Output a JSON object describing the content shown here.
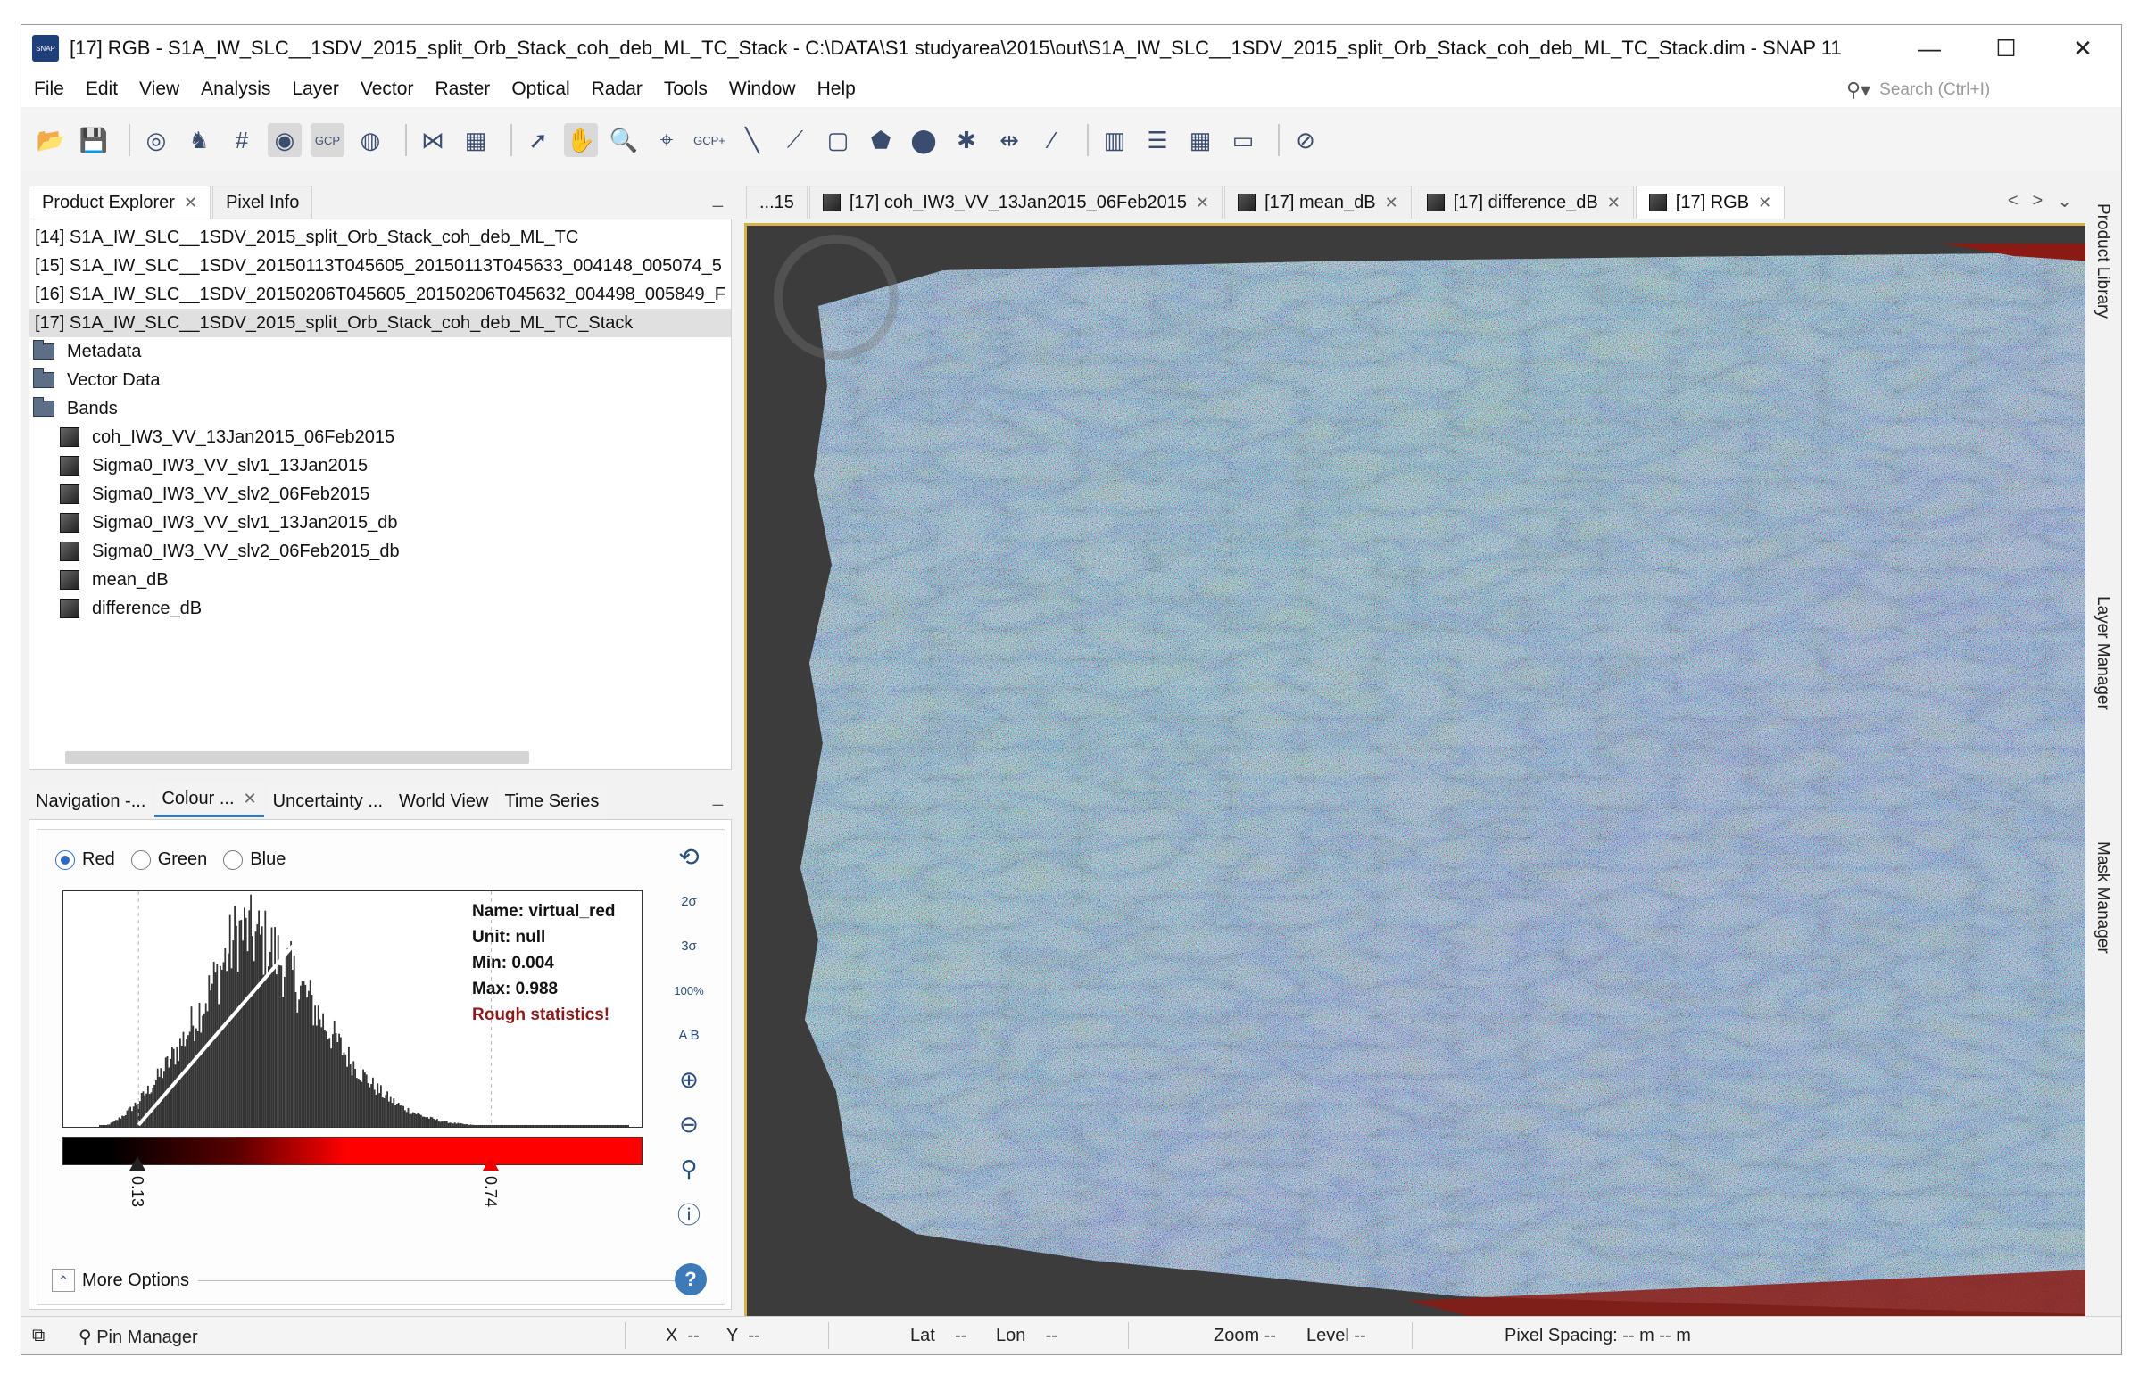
{
  "window": {
    "title": "[17] RGB - S1A_IW_SLC__1SDV_2015_split_Orb_Stack_coh_deb_ML_TC_Stack - C:\\DATA\\S1 studyarea\\2015\\out\\S1A_IW_SLC__1SDV_2015_split_Orb_Stack_coh_deb_ML_TC_Stack.dim - SNAP 11",
    "app_icon_text": "SNAP",
    "minimize": "—",
    "maximize": "☐",
    "close": "✕"
  },
  "menu": [
    "File",
    "Edit",
    "View",
    "Analysis",
    "Layer",
    "Vector",
    "Raster",
    "Optical",
    "Radar",
    "Tools",
    "Window",
    "Help"
  ],
  "search": {
    "placeholder": "Search (Ctrl+I)"
  },
  "product_explorer": {
    "tabs": [
      {
        "label": "Product Explorer",
        "closable": true
      },
      {
        "label": "Pixel Info",
        "closable": false
      }
    ],
    "minimize": "_",
    "products": [
      "[14] S1A_IW_SLC__1SDV_2015_split_Orb_Stack_coh_deb_ML_TC",
      "[15] S1A_IW_SLC__1SDV_20150113T045605_20150113T045633_004148_005074_5",
      "[16] S1A_IW_SLC__1SDV_20150206T045605_20150206T045632_004498_005849_F",
      "[17] S1A_IW_SLC__1SDV_2015_split_Orb_Stack_coh_deb_ML_TC_Stack"
    ],
    "folders": [
      "Metadata",
      "Vector Data",
      "Bands"
    ],
    "bands": [
      "coh_IW3_VV_13Jan2015_06Feb2015",
      "Sigma0_IW3_VV_slv1_13Jan2015",
      "Sigma0_IW3_VV_slv2_06Feb2015",
      "Sigma0_IW3_VV_slv1_13Jan2015_db",
      "Sigma0_IW3_VV_slv2_06Feb2015_db",
      "mean_dB",
      "difference_dB"
    ]
  },
  "colour_panel": {
    "tabs": [
      "Navigation -...",
      "Colour ...",
      "Uncertainty ...",
      "World View",
      "Time Series"
    ],
    "close_tab": "✕",
    "minimize": "_",
    "channels": [
      "Red",
      "Green",
      "Blue"
    ],
    "selected_channel": "Red",
    "stats": {
      "name": "Name: virtual_red",
      "unit": "Unit: null",
      "min": "Min: 0.004",
      "max": "Max: 0.988",
      "warning": "Rough statistics!"
    },
    "slider_min": "0.13",
    "slider_max": "0.74",
    "slider_min_frac": 0.13,
    "slider_max_frac": 0.74,
    "more_options": "More Options",
    "side_buttons": [
      "reset-icon",
      "2σ",
      "3σ",
      "100%",
      "A B",
      "zoom-in-v-icon",
      "zoom-out-v-icon",
      "zoom-icon",
      "info-icon"
    ],
    "help": "?"
  },
  "image_tabs": [
    {
      "label": "...15",
      "icon": false,
      "closable": false
    },
    {
      "label": "[17] coh_IW3_VV_13Jan2015_06Feb2015",
      "icon": true,
      "closable": true
    },
    {
      "label": "[17] mean_dB",
      "icon": true,
      "closable": true
    },
    {
      "label": "[17] difference_dB",
      "icon": true,
      "closable": true
    },
    {
      "label": "[17] RGB",
      "icon": true,
      "closable": true,
      "selected": true
    }
  ],
  "image_nav": {
    "prev": "<",
    "next": ">",
    "list": "⌄",
    "max": "☐"
  },
  "right_strip": [
    "Product Library",
    "Layer Manager",
    "Mask Manager"
  ],
  "status": {
    "pin_manager": "Pin Manager",
    "x": "X",
    "x_val": "--",
    "y": "Y",
    "y_val": "--",
    "lat": "Lat",
    "lat_val": "--",
    "lon": "Lon",
    "lon_val": "--",
    "zoom": "Zoom --",
    "level": "Level --",
    "pixel_spacing": "Pixel Spacing: -- m -- m"
  },
  "colors": {
    "accent": "#3d7ab8",
    "warning": "#8b1a1a",
    "image_border": "#d6b24a"
  }
}
